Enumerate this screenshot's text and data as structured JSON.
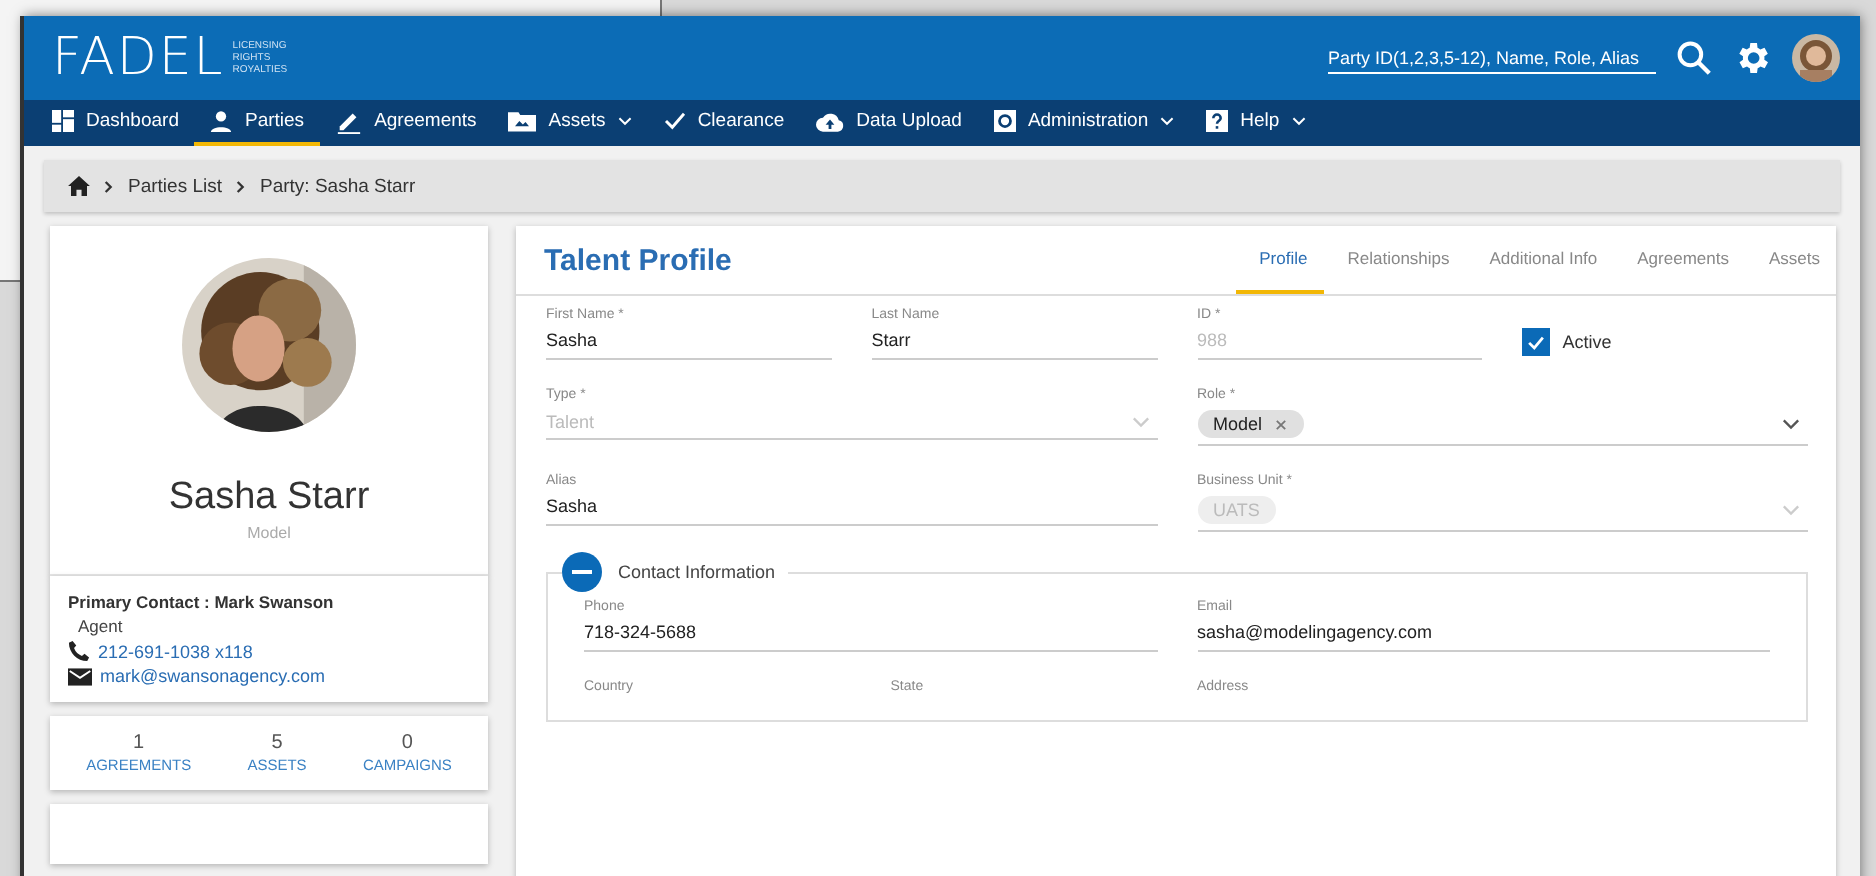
{
  "header": {
    "logo": "FADEL",
    "tagline": [
      "LICENSING",
      "RIGHTS",
      "ROYALTIES"
    ],
    "search": {
      "placeholder": "Party ID(1,2,3,5-12), Name, Role, Alias"
    }
  },
  "nav": [
    {
      "label": "Dashboard",
      "dropdown": false,
      "selected": false
    },
    {
      "label": "Parties",
      "dropdown": false,
      "selected": true
    },
    {
      "label": "Agreements",
      "dropdown": false,
      "selected": false
    },
    {
      "label": "Assets",
      "dropdown": true,
      "selected": false
    },
    {
      "label": "Clearance",
      "dropdown": false,
      "selected": false
    },
    {
      "label": "Data Upload",
      "dropdown": false,
      "selected": false
    },
    {
      "label": "Administration",
      "dropdown": true,
      "selected": false
    },
    {
      "label": "Help",
      "dropdown": true,
      "selected": false
    }
  ],
  "breadcrumb": [
    "Parties List",
    "Party: Sasha Starr"
  ],
  "profile": {
    "name": "Sasha Starr",
    "role": "Model",
    "primary_contact": {
      "title": "Primary Contact : Mark Swanson",
      "role": "Agent",
      "phone": "212-691-1038 x118",
      "email": "mark@swansonagency.com"
    },
    "stats": [
      {
        "count": "1",
        "label": "AGREEMENTS"
      },
      {
        "count": "5",
        "label": "ASSETS"
      },
      {
        "count": "0",
        "label": "CAMPAIGNS"
      }
    ]
  },
  "main": {
    "title": "Talent Profile",
    "tabs": [
      {
        "label": "Profile",
        "selected": true
      },
      {
        "label": "Relationships",
        "selected": false
      },
      {
        "label": "Additional Info",
        "selected": false
      },
      {
        "label": "Agreements",
        "selected": false
      },
      {
        "label": "Assets",
        "selected": false
      }
    ],
    "rows": [
      [
        {
          "kind": "text",
          "label": "First Name *",
          "value": "Sasha",
          "disabled": false
        },
        {
          "kind": "text",
          "label": "Last Name",
          "value": "Starr",
          "disabled": false
        },
        {
          "kind": "text",
          "label": "ID *",
          "value": "988",
          "disabled": true
        },
        {
          "kind": "checkbox",
          "label": "Active",
          "checked": true
        }
      ],
      [
        {
          "kind": "select",
          "label": "Type *",
          "value": "Talent",
          "disabled": true
        },
        {
          "kind": "chips",
          "label": "Role *",
          "chips": [
            "Model"
          ],
          "disabled": false
        }
      ],
      [
        {
          "kind": "text",
          "label": "Alias",
          "value": "Sasha",
          "disabled": false
        },
        {
          "kind": "chips",
          "label": "Business Unit *",
          "chips": [
            "UATS"
          ],
          "disabled": true
        }
      ]
    ],
    "contact": {
      "title": "Contact Information",
      "expanded": true,
      "fields": [
        {
          "kind": "text",
          "label": "Phone",
          "value": "718-324-5688",
          "disabled": false
        },
        {
          "kind": "text",
          "label": "Email",
          "value": "sasha@modelingagency.com",
          "disabled": false
        },
        {
          "kind": "label",
          "label": "Country"
        },
        {
          "kind": "label",
          "label": "State"
        },
        {
          "kind": "label",
          "label": "Address"
        }
      ]
    }
  }
}
